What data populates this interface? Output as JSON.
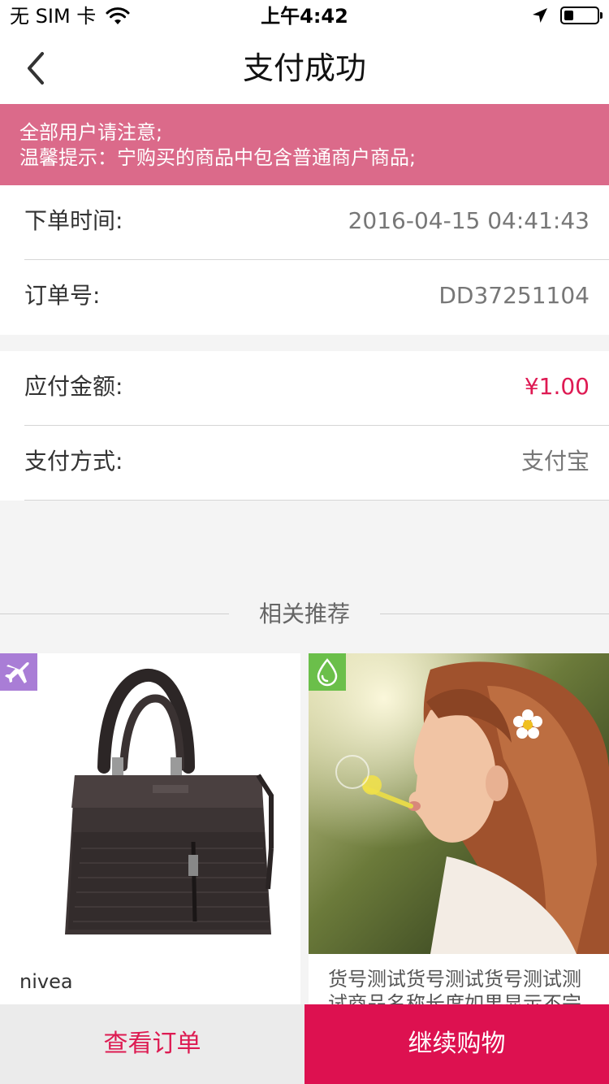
{
  "status_bar": {
    "carrier": "无 SIM 卡",
    "time": "上午4:42",
    "battery_level": 0.3
  },
  "nav": {
    "title": "支付成功"
  },
  "notice": {
    "line1": "全部用户请注意;",
    "line2": "温馨提示：宁购买的商品中包含普通商户商品;"
  },
  "order_info": {
    "order_time_label": "下单时间:",
    "order_time_value": "2016-04-15 04:41:43",
    "order_no_label": "订单号:",
    "order_no_value": "DD37251104"
  },
  "payment_info": {
    "amount_label": "应付金额:",
    "amount_value": "¥1.00",
    "method_label": "支付方式:",
    "method_value": "支付宝"
  },
  "recommend": {
    "title": "相关推荐",
    "products": [
      {
        "name": "nivea",
        "badge": "plane-icon"
      },
      {
        "name": "货号测试货号测试货号测试测试商品名称长度如果显示不完",
        "badge": "water-drop-icon"
      }
    ]
  },
  "bottom_bar": {
    "view_order_label": "查看订单",
    "continue_shopping_label": "继续购物"
  },
  "colors": {
    "accent": "#dd1150",
    "notice_bg": "#db6a8a",
    "badge_purple": "#a97dd6",
    "badge_green": "#6bbf4a"
  }
}
